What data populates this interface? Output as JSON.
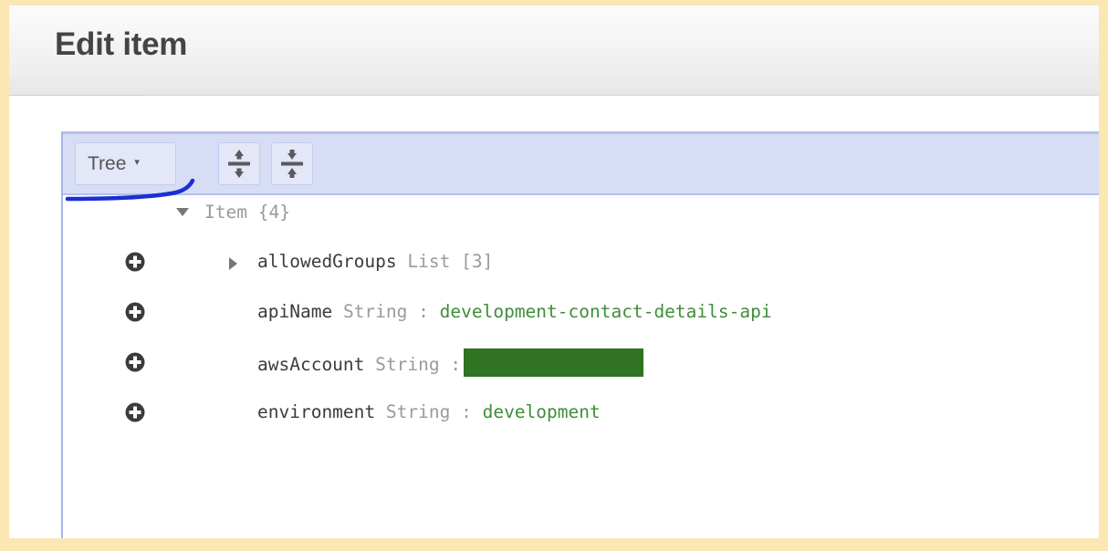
{
  "page": {
    "title": "Edit item",
    "frame_color": "#fbe6b4"
  },
  "editor": {
    "toolbar": {
      "mode_select": {
        "label": "Tree",
        "caret": "▾",
        "icon": "chevron-down-icon"
      },
      "expand_all": {
        "label": "Expand all",
        "icon": "expand-all-icon"
      },
      "collapse_all": {
        "label": "Collapse all",
        "icon": "collapse-all-icon"
      },
      "background_color": "#d7ddf4",
      "border_color": "#b6c1ec"
    },
    "annotation": {
      "type": "hand-drawn-underline",
      "color": "#1a2fd4"
    },
    "tree": {
      "root": {
        "label": "Item",
        "count": "{4}",
        "expanded": true,
        "toggle_icon": "triangle-down-icon"
      },
      "rows": [
        {
          "add_icon": "plus-circle-icon",
          "toggle_icon": "triangle-right-icon",
          "expanded": false,
          "key": "allowedGroups",
          "type": "List",
          "separator": "",
          "count": "[3]",
          "value": "",
          "redacted": false
        },
        {
          "add_icon": "plus-circle-icon",
          "toggle_icon": "",
          "expanded": false,
          "key": "apiName",
          "type": "String",
          "separator": ":",
          "count": "",
          "value": "development-contact-details-api",
          "redacted": false
        },
        {
          "add_icon": "plus-circle-icon",
          "toggle_icon": "",
          "expanded": false,
          "key": "awsAccount",
          "type": "String",
          "separator": ":",
          "count": "",
          "value": "",
          "redacted": true
        },
        {
          "add_icon": "plus-circle-icon",
          "toggle_icon": "",
          "expanded": false,
          "key": "environment",
          "type": "String",
          "separator": ":",
          "count": "",
          "value": "development",
          "redacted": false
        }
      ]
    },
    "colors": {
      "value_green": "#3f8e3a",
      "redaction_green": "#2f7323",
      "key_gray": "#3c3c3c",
      "type_gray": "#9a9a9a"
    }
  }
}
